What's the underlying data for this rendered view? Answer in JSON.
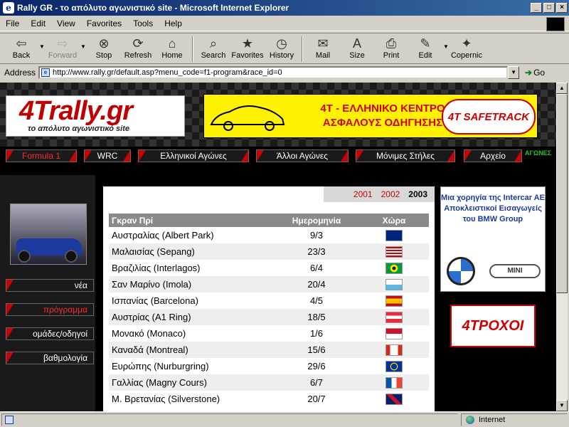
{
  "window": {
    "title": "Rally GR - το απόλυτο αγωνιστικό site - Microsoft Internet Explorer",
    "minimize": "_",
    "maximize": "□",
    "close": "×"
  },
  "menu": [
    "File",
    "Edit",
    "View",
    "Favorites",
    "Tools",
    "Help"
  ],
  "toolbar": {
    "back": "Back",
    "forward": "Forward",
    "stop": "Stop",
    "refresh": "Refresh",
    "home": "Home",
    "search": "Search",
    "favorites": "Favorites",
    "history": "History",
    "mail": "Mail",
    "size": "Size",
    "print": "Print",
    "edit": "Edit",
    "copernic": "Copernic"
  },
  "address": {
    "label": "Address",
    "url": "http://www.rally.gr/default.asp?menu_code=f1-program&race_id=0",
    "go": "Go"
  },
  "status": {
    "zone": "Internet"
  },
  "site": {
    "logo_text": "4Trally.gr",
    "logo_tagline": "το απόλυτο αγωνιστικό site",
    "banner_text_line1": "4T - ΕΛΛΗΝΙΚΟ ΚΕΝΤΡΟ",
    "banner_text_line2": "ΑΣΦΑΛΟΥΣ ΟΔΗΓΗΣΗΣ",
    "banner_brand": "4T SAFETRACK",
    "nav": [
      "Formula 1",
      "WRC",
      "Ελληνικοί Αγώνες",
      "Άλλοι Αγώνες",
      "Μόνιμες Στήλες",
      "Αρχείο"
    ],
    "nav_small": "ΑΓΩΝΕΣ",
    "side": [
      "νέα",
      "πρόγραμμα",
      "ομάδες/οδηγοί",
      "βαθμολογία"
    ],
    "years": [
      "2001",
      "2002",
      "2003"
    ],
    "sponsor_text": "Μια χορηγία της Intercar AE Αποκλειστικοί Εισαγωγείς του BMW Group",
    "sponsor_bmw": "BMW",
    "sponsor_mini": "MINI",
    "ad_trochoi": "4ΤΡΟΧΟΙ"
  },
  "table": {
    "headers": [
      "Γκραν Πρί",
      "Ημερομηνία",
      "Χώρα"
    ],
    "rows": [
      {
        "gp": "Αυστραλίας (Albert Park)",
        "date": "9/3",
        "flag": "au"
      },
      {
        "gp": "Μαλαισίας (Sepang)",
        "date": "23/3",
        "flag": "my"
      },
      {
        "gp": "Βραζιλίας (Interlagos)",
        "date": "6/4",
        "flag": "br"
      },
      {
        "gp": "Σαν Μαρίνο (Imola)",
        "date": "20/4",
        "flag": "sm"
      },
      {
        "gp": "Ισπανίας (Barcelona)",
        "date": "4/5",
        "flag": "es"
      },
      {
        "gp": "Αυστρίας (A1 Ring)",
        "date": "18/5",
        "flag": "at"
      },
      {
        "gp": "Μονακό (Monaco)",
        "date": "1/6",
        "flag": "mc"
      },
      {
        "gp": "Καναδά (Montreal)",
        "date": "15/6",
        "flag": "ca"
      },
      {
        "gp": "Ευρώπης (Nurburgring)",
        "date": "29/6",
        "flag": "eu"
      },
      {
        "gp": "Γαλλίας (Magny Cours)",
        "date": "6/7",
        "flag": "fr"
      },
      {
        "gp": "Μ. Βρετανίας (Silverstone)",
        "date": "20/7",
        "flag": "gb"
      }
    ]
  }
}
